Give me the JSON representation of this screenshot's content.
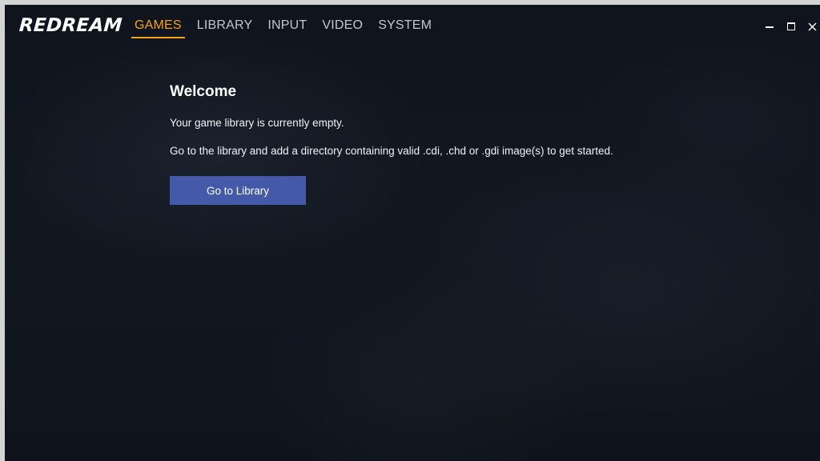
{
  "app": {
    "logo_text": "REDREAM"
  },
  "nav": {
    "items": [
      {
        "label": "GAMES",
        "active": true
      },
      {
        "label": "LIBRARY",
        "active": false
      },
      {
        "label": "INPUT",
        "active": false
      },
      {
        "label": "VIDEO",
        "active": false
      },
      {
        "label": "SYSTEM",
        "active": false
      }
    ]
  },
  "window_controls": {
    "minimize_icon": "minimize-icon",
    "maximize_icon": "maximize-icon",
    "close_icon": "close-icon",
    "close_glyph": "×"
  },
  "main": {
    "title": "Welcome",
    "message_empty": "Your game library is currently empty.",
    "message_instructions": "Go to the library and add a directory containing valid .cdi, .chd or .gdi image(s) to get started.",
    "button_label": "Go to Library"
  },
  "colors": {
    "accent": "#f5a21a",
    "button": "#4459a8",
    "background": "#121822",
    "nav_text": "#c3c7ce"
  }
}
